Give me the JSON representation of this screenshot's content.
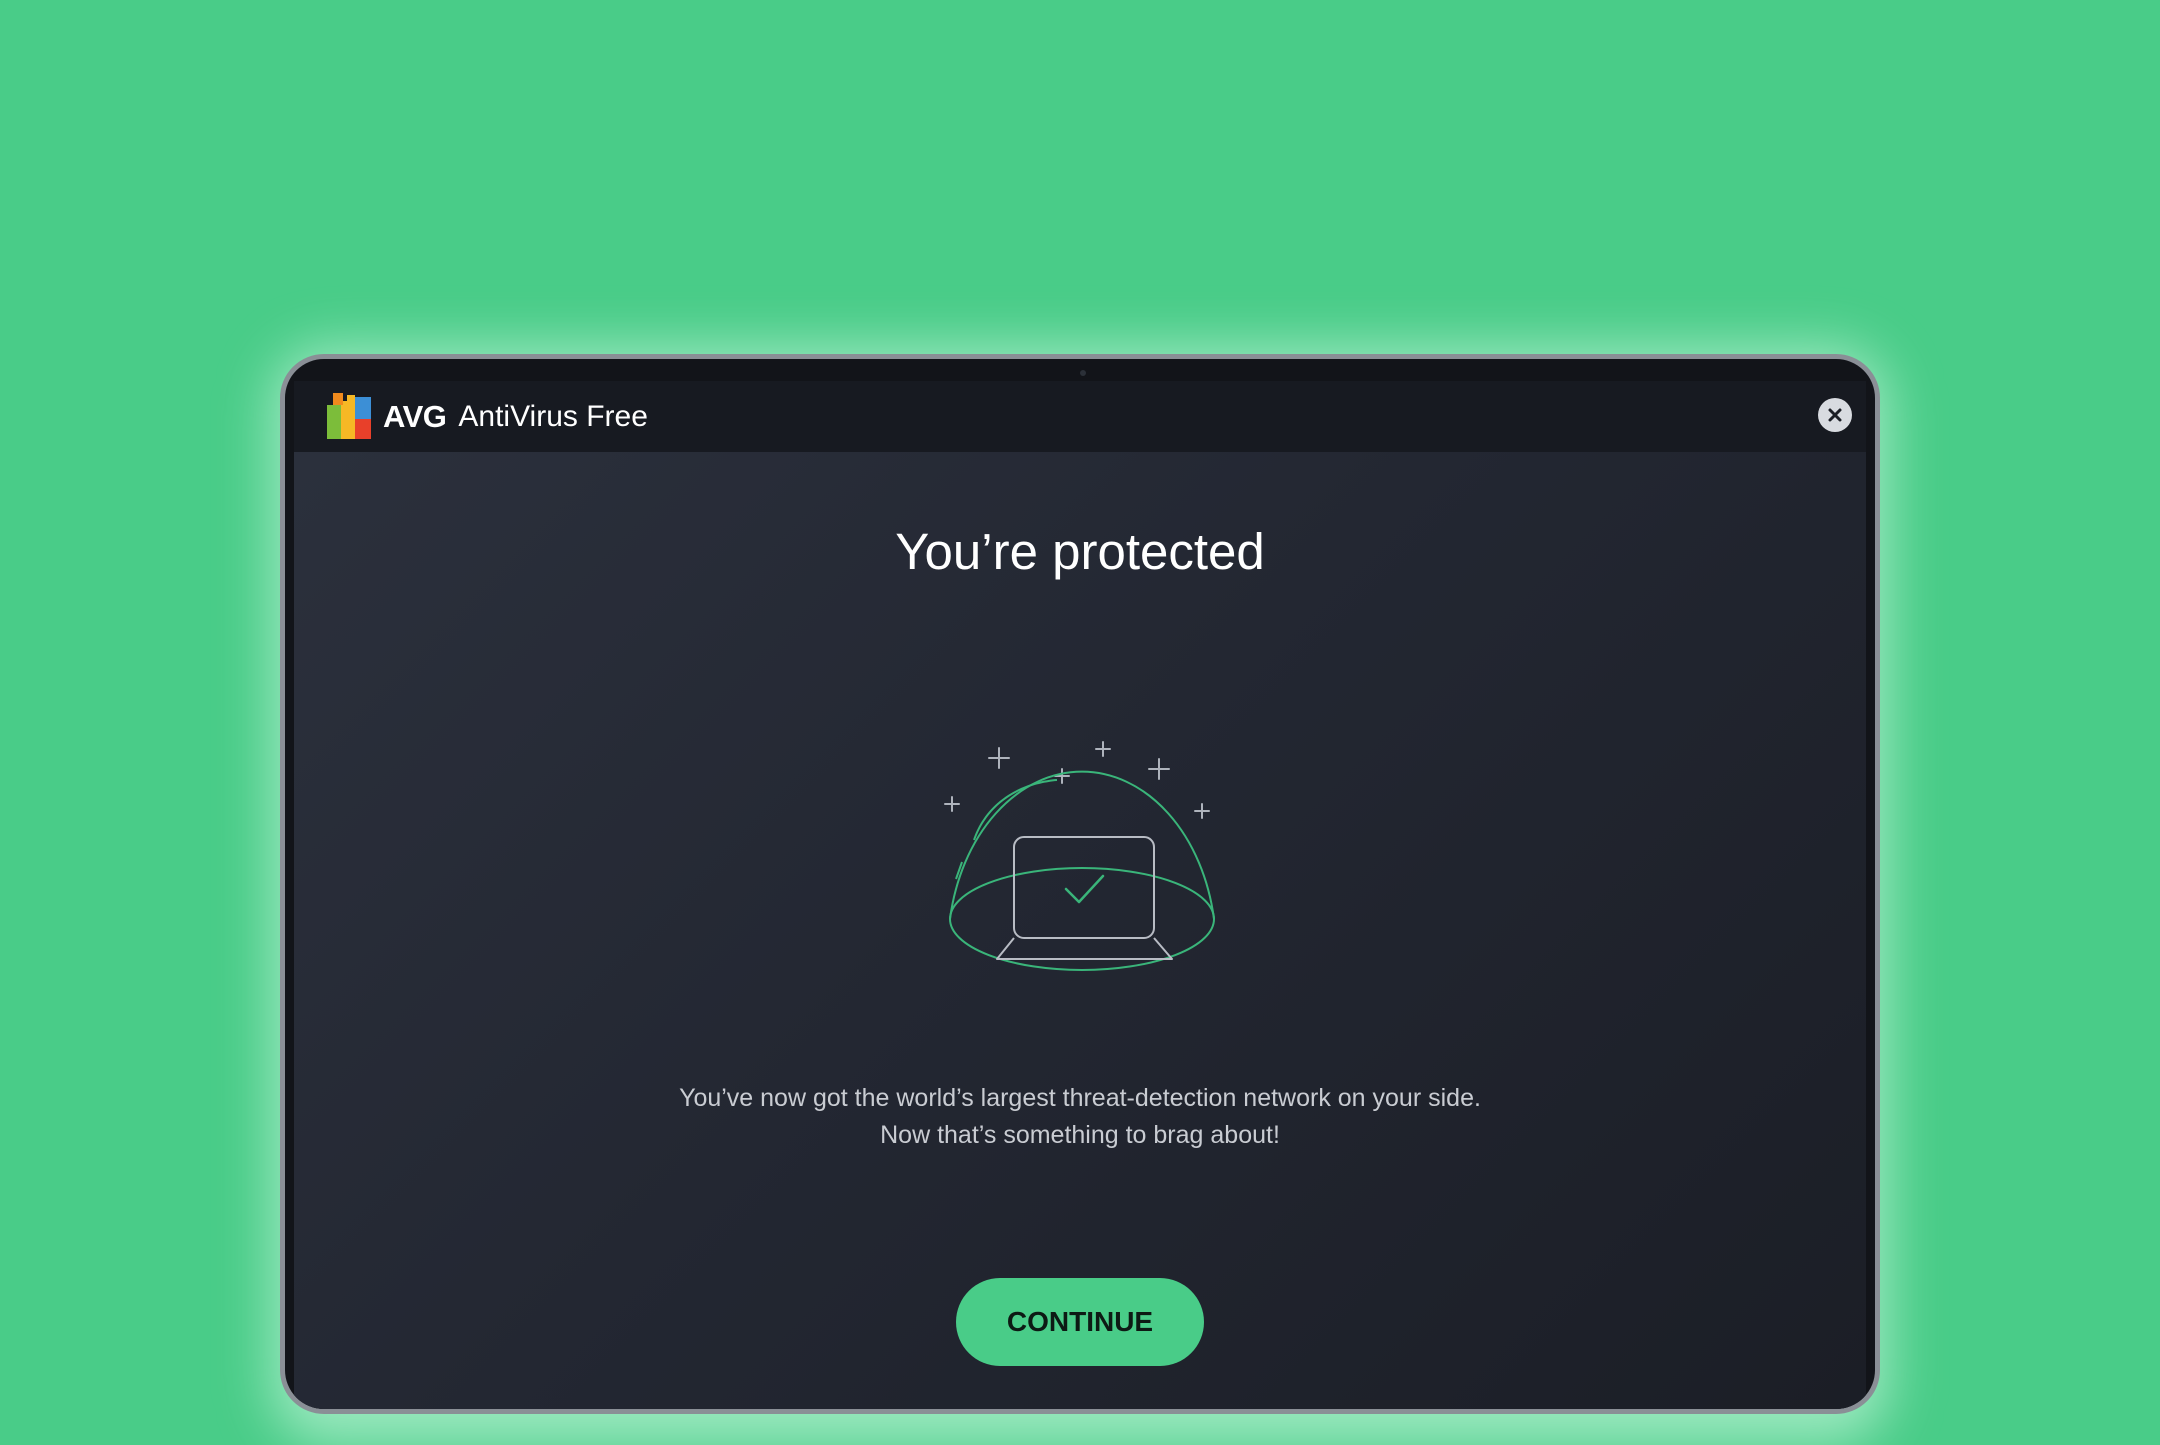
{
  "app": {
    "brand": "AVG",
    "product": "AntiVirus Free"
  },
  "dialog": {
    "headline": "You’re protected",
    "message_lines": [
      "You’ve now got the world’s largest threat-detection network on your side.",
      "Now that’s something to brag about!"
    ],
    "continue_label": "CONTINUE"
  },
  "icons": {
    "logo": "avg-logo",
    "close": "close-icon",
    "illustration": "protected-laptop-illustration"
  },
  "colors": {
    "background": "#49cc88",
    "accent": "#49cc88",
    "titlebar": "#171a21",
    "panel": "#232732"
  }
}
